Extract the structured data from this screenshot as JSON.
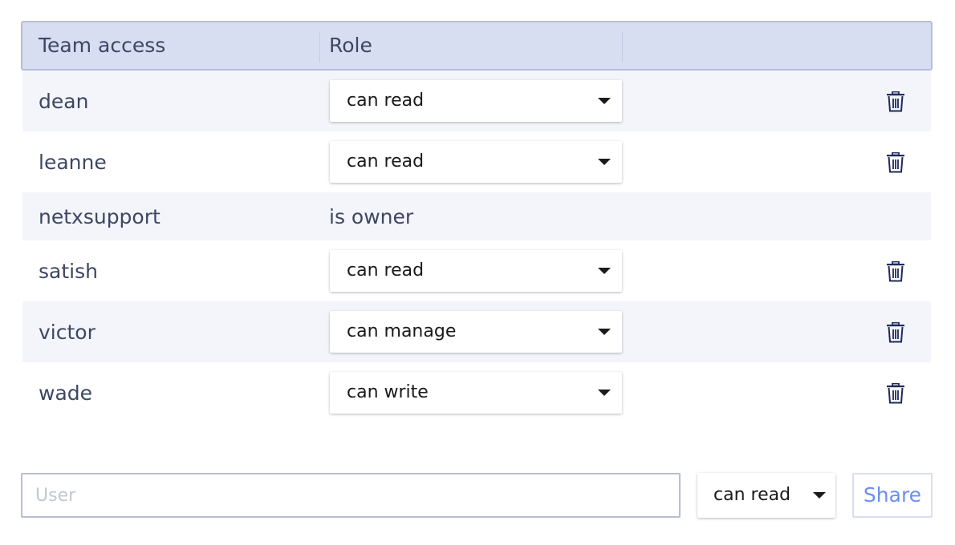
{
  "table": {
    "headers": {
      "team_access": "Team access",
      "role": "Role"
    },
    "rows": [
      {
        "user": "dean",
        "role": "can read",
        "editable": true
      },
      {
        "user": "leanne",
        "role": "can read",
        "editable": true
      },
      {
        "user": "netxsupport",
        "role": "is owner",
        "editable": false
      },
      {
        "user": "satish",
        "role": "can read",
        "editable": true
      },
      {
        "user": "victor",
        "role": "can manage",
        "editable": true
      },
      {
        "user": "wade",
        "role": "can write",
        "editable": true
      }
    ]
  },
  "share": {
    "user_placeholder": "User",
    "user_value": "",
    "role_value": "can read",
    "button_label": "Share"
  },
  "icons": {
    "delete": "trash-icon",
    "dropdown": "caret-down-icon"
  },
  "colors": {
    "header_bg": "#d8def2",
    "row_shade": "#f4f5fb",
    "text": "#3d4763",
    "icon": "#1f2a5c",
    "accent": "#6b8ef0"
  }
}
